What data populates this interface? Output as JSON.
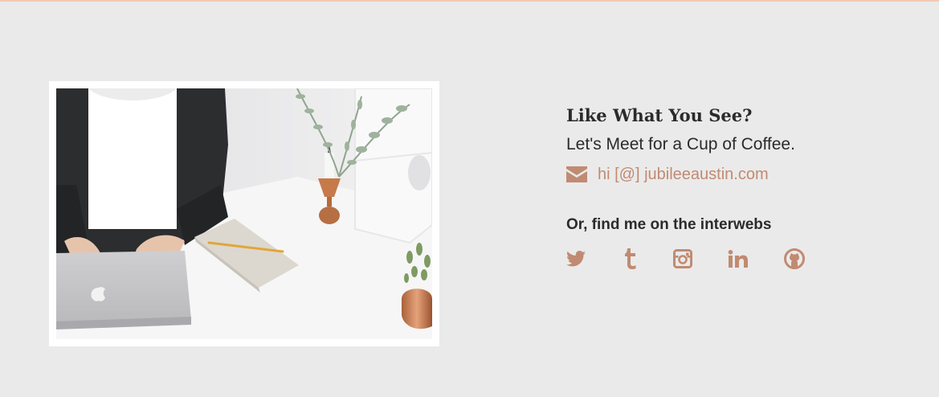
{
  "contact": {
    "headline": "Like What You See?",
    "subline": "Let's Meet for a Cup of Coffee.",
    "email_icon": "envelope-icon",
    "email_text": "hi [@] jubileeaustin.com"
  },
  "social": {
    "heading": "Or, find me on the interwebs",
    "icons": [
      "twitter-icon",
      "tumblr-icon",
      "instagram-icon",
      "linkedin-icon",
      "github-icon"
    ]
  },
  "colors": {
    "accent": "#c08b72",
    "background": "#ebeaea",
    "text": "#2b2b2b",
    "top_rule": "#f3c9b0"
  }
}
